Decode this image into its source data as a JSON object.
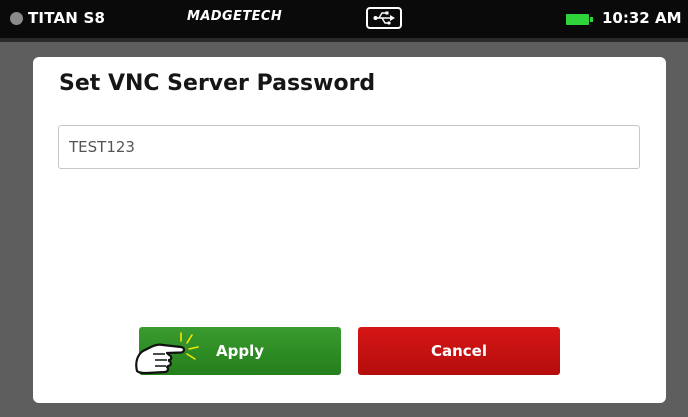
{
  "statusbar": {
    "device_name": "TITAN S8",
    "brand": "MADGETECH",
    "time": "10:32 AM",
    "icons": [
      "power-dot-icon",
      "usb-icon",
      "battery-icon"
    ],
    "battery_color": "#2fd33a"
  },
  "dialog": {
    "title": "Set VNC Server Password",
    "password_value": "TEST123",
    "apply_label": "Apply",
    "cancel_label": "Cancel",
    "apply_color": "#2d8c22",
    "cancel_color": "#c81010"
  }
}
